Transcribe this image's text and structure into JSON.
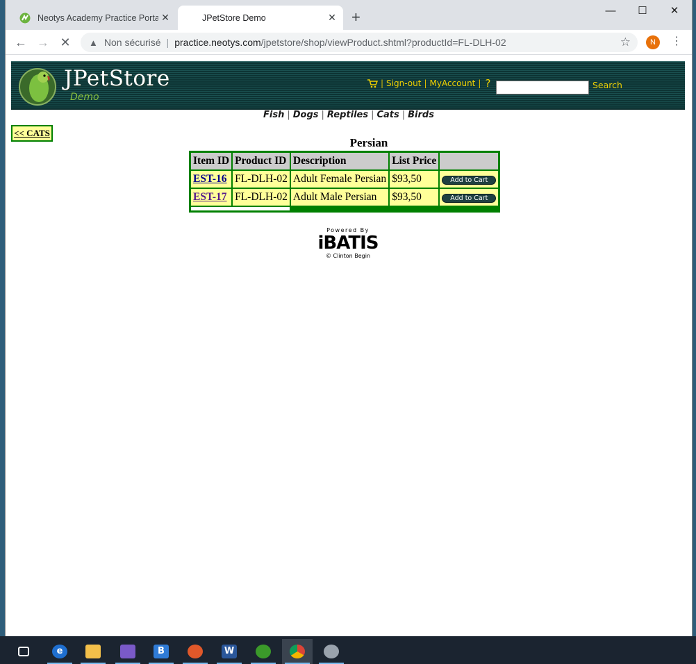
{
  "browser": {
    "tabs": [
      {
        "title": "Neotys Academy Practice Portal",
        "active": false
      },
      {
        "title": "JPetStore Demo",
        "active": true
      }
    ],
    "new_tab": "+",
    "url_security": "Non sécurisé",
    "url_host": "practice.neotys.com",
    "url_path": "/jpetstore/shop/viewProduct.shtml?productId=FL-DLH-02",
    "profile_initial": "N",
    "controls": {
      "minimize": "—",
      "maximize": "☐",
      "close": "✕"
    }
  },
  "header": {
    "logo_title": "JPetStore",
    "logo_subtitle": "Demo",
    "links": {
      "signout": "Sign-out",
      "account": "MyAccount",
      "help": "?"
    },
    "search_value": "",
    "search_label": "Search"
  },
  "categories": [
    "Fish",
    "Dogs",
    "Reptiles",
    "Cats",
    "Birds"
  ],
  "back_link": "<< CATS",
  "product": {
    "name": "Persian",
    "columns": [
      "Item ID",
      "Product ID",
      "Description",
      "List Price",
      ""
    ],
    "rows": [
      {
        "item_id": "EST-16",
        "product_id": "FL-DLH-02",
        "description": "Adult Female Persian",
        "price": "$93,50",
        "action": "Add to Cart"
      },
      {
        "item_id": "EST-17",
        "product_id": "FL-DLH-02",
        "description": "Adult Male Persian",
        "price": "$93,50",
        "action": "Add to Cart"
      }
    ]
  },
  "footer": {
    "powered_by": "Powered By",
    "brand": "iBATIS",
    "copyright": "© Clinton Begin"
  },
  "taskbar": {
    "apps": [
      "task-view",
      "edge",
      "file-explorer",
      "snipping",
      "bi",
      "firefox",
      "word",
      "neoload",
      "chrome",
      "disk"
    ]
  },
  "colors": {
    "banner_bg": "#0f3c3c",
    "link_yellow": "#f0d000",
    "table_border": "#008000",
    "cell_bg": "#ffff99",
    "header_cell_bg": "#cccccc"
  }
}
